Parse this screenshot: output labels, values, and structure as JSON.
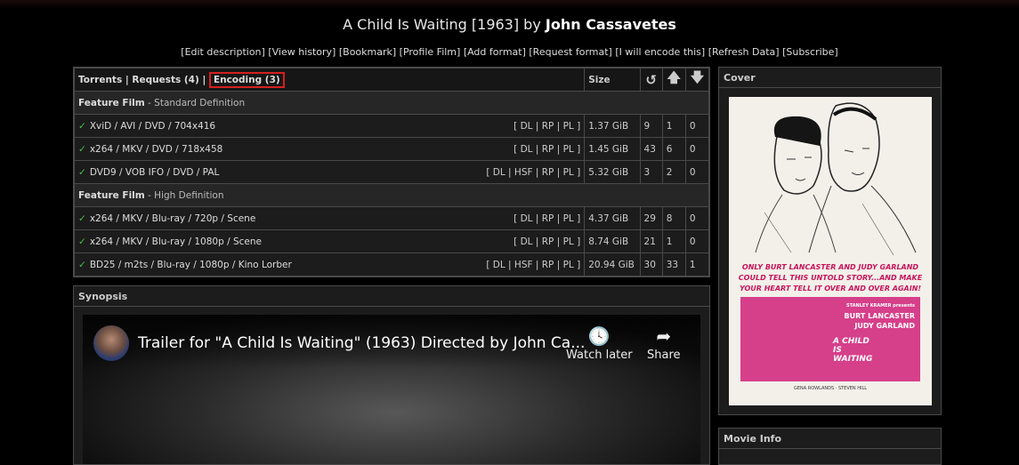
{
  "title": {
    "main": "A Child Is Waiting [1963] by ",
    "director": "John Cassavetes"
  },
  "links": [
    "[Edit description]",
    "[View history]",
    "[Bookmark]",
    "[Profile Film]",
    "[Add format]",
    "[Request format]",
    "[I will encode this]",
    "[Refresh Data]",
    "[Subscribe]"
  ],
  "tabs": {
    "torrents": "Torrents",
    "sep1": "|",
    "requests": "Requests (4)",
    "sep2": "|",
    "encoding": "Encoding (3)"
  },
  "columns": {
    "size": "Size",
    "reseed_icon": "refresh-icon",
    "seeders_icon": "arrow-up-icon",
    "leechers_icon": "arrow-down-icon"
  },
  "groups": [
    {
      "label": "Feature Film",
      "sub": " - Standard Definition"
    },
    {
      "label": "Feature Film",
      "sub": " - High Definition"
    }
  ],
  "rows": [
    {
      "name": "XviD / AVI / DVD / 704x416",
      "actions": "[ DL | RP | PL ]",
      "size": "1.37 GiB",
      "snatched": "9",
      "seeders": "1",
      "leechers": "0"
    },
    {
      "name": "x264 / MKV / DVD / 718x458",
      "actions": "[ DL | RP | PL ]",
      "size": "1.45 GiB",
      "snatched": "43",
      "seeders": "6",
      "leechers": "0"
    },
    {
      "name": "DVD9 / VOB IFO / DVD / PAL",
      "actions": "[ DL | HSF | RP | PL ]",
      "size": "5.32 GiB",
      "snatched": "3",
      "seeders": "2",
      "leechers": "0"
    },
    {
      "name": "x264 / MKV / Blu-ray / 720p / Scene",
      "actions": "[ DL | RP | PL ]",
      "size": "4.37 GiB",
      "snatched": "29",
      "seeders": "8",
      "leechers": "0"
    },
    {
      "name": "x264 / MKV / Blu-ray / 1080p / Scene",
      "actions": "[ DL | RP | PL ]",
      "size": "8.74 GiB",
      "snatched": "21",
      "seeders": "1",
      "leechers": "0"
    },
    {
      "name": "BD25 / m2ts / Blu-ray / 1080p / Kino Lorber",
      "actions": "[ DL | HSF | RP | PL ]",
      "size": "20.94 GiB",
      "snatched": "30",
      "seeders": "33",
      "leechers": "1"
    }
  ],
  "synopsis": {
    "header": "Synopsis",
    "video_title": "Trailer for \"A Child Is Waiting\" (1963) Directed by John Ca...",
    "watch_later": "Watch later",
    "share": "Share"
  },
  "cover": {
    "header": "Cover",
    "tagline": "ONLY BURT LANCASTER AND JUDY GARLAND COULD TELL THIS UNTOLD STORY...AND MAKE YOUR HEART TELL IT OVER AND OVER AGAIN!",
    "presents": "STANLEY KRAMER presents",
    "star1": "BURT LANCASTER",
    "star2": "JUDY GARLAND",
    "film_title": "A CHILD IS WAITING",
    "credits": "GENA ROWLANDS · STEVEN HILL"
  },
  "movie_info": {
    "header": "Movie Info"
  },
  "colors": {
    "encoding_highlight": "#d42020",
    "check": "#44c244",
    "poster_pink": "#d63f8a"
  }
}
